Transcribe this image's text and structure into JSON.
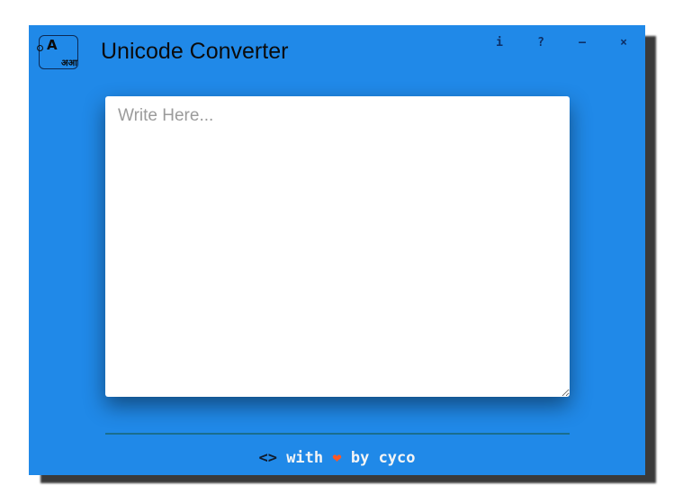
{
  "app": {
    "title": "Unicode Converter",
    "logo": {
      "latin": "A",
      "devanagari": "अआ"
    }
  },
  "controls": [
    {
      "name": "info-button",
      "label": "i"
    },
    {
      "name": "help-button",
      "label": "?"
    },
    {
      "name": "minimize-button",
      "label": "—"
    },
    {
      "name": "close-button",
      "label": "×"
    }
  ],
  "editor": {
    "placeholder": "Write Here...",
    "value": ""
  },
  "footer": {
    "code": "<>",
    "with": " with ",
    "heart": "❤",
    "by": " by cyco"
  },
  "colors": {
    "window_bg": "#2089e8",
    "heart": "#ff5722",
    "divider": "#1a6e8e"
  }
}
